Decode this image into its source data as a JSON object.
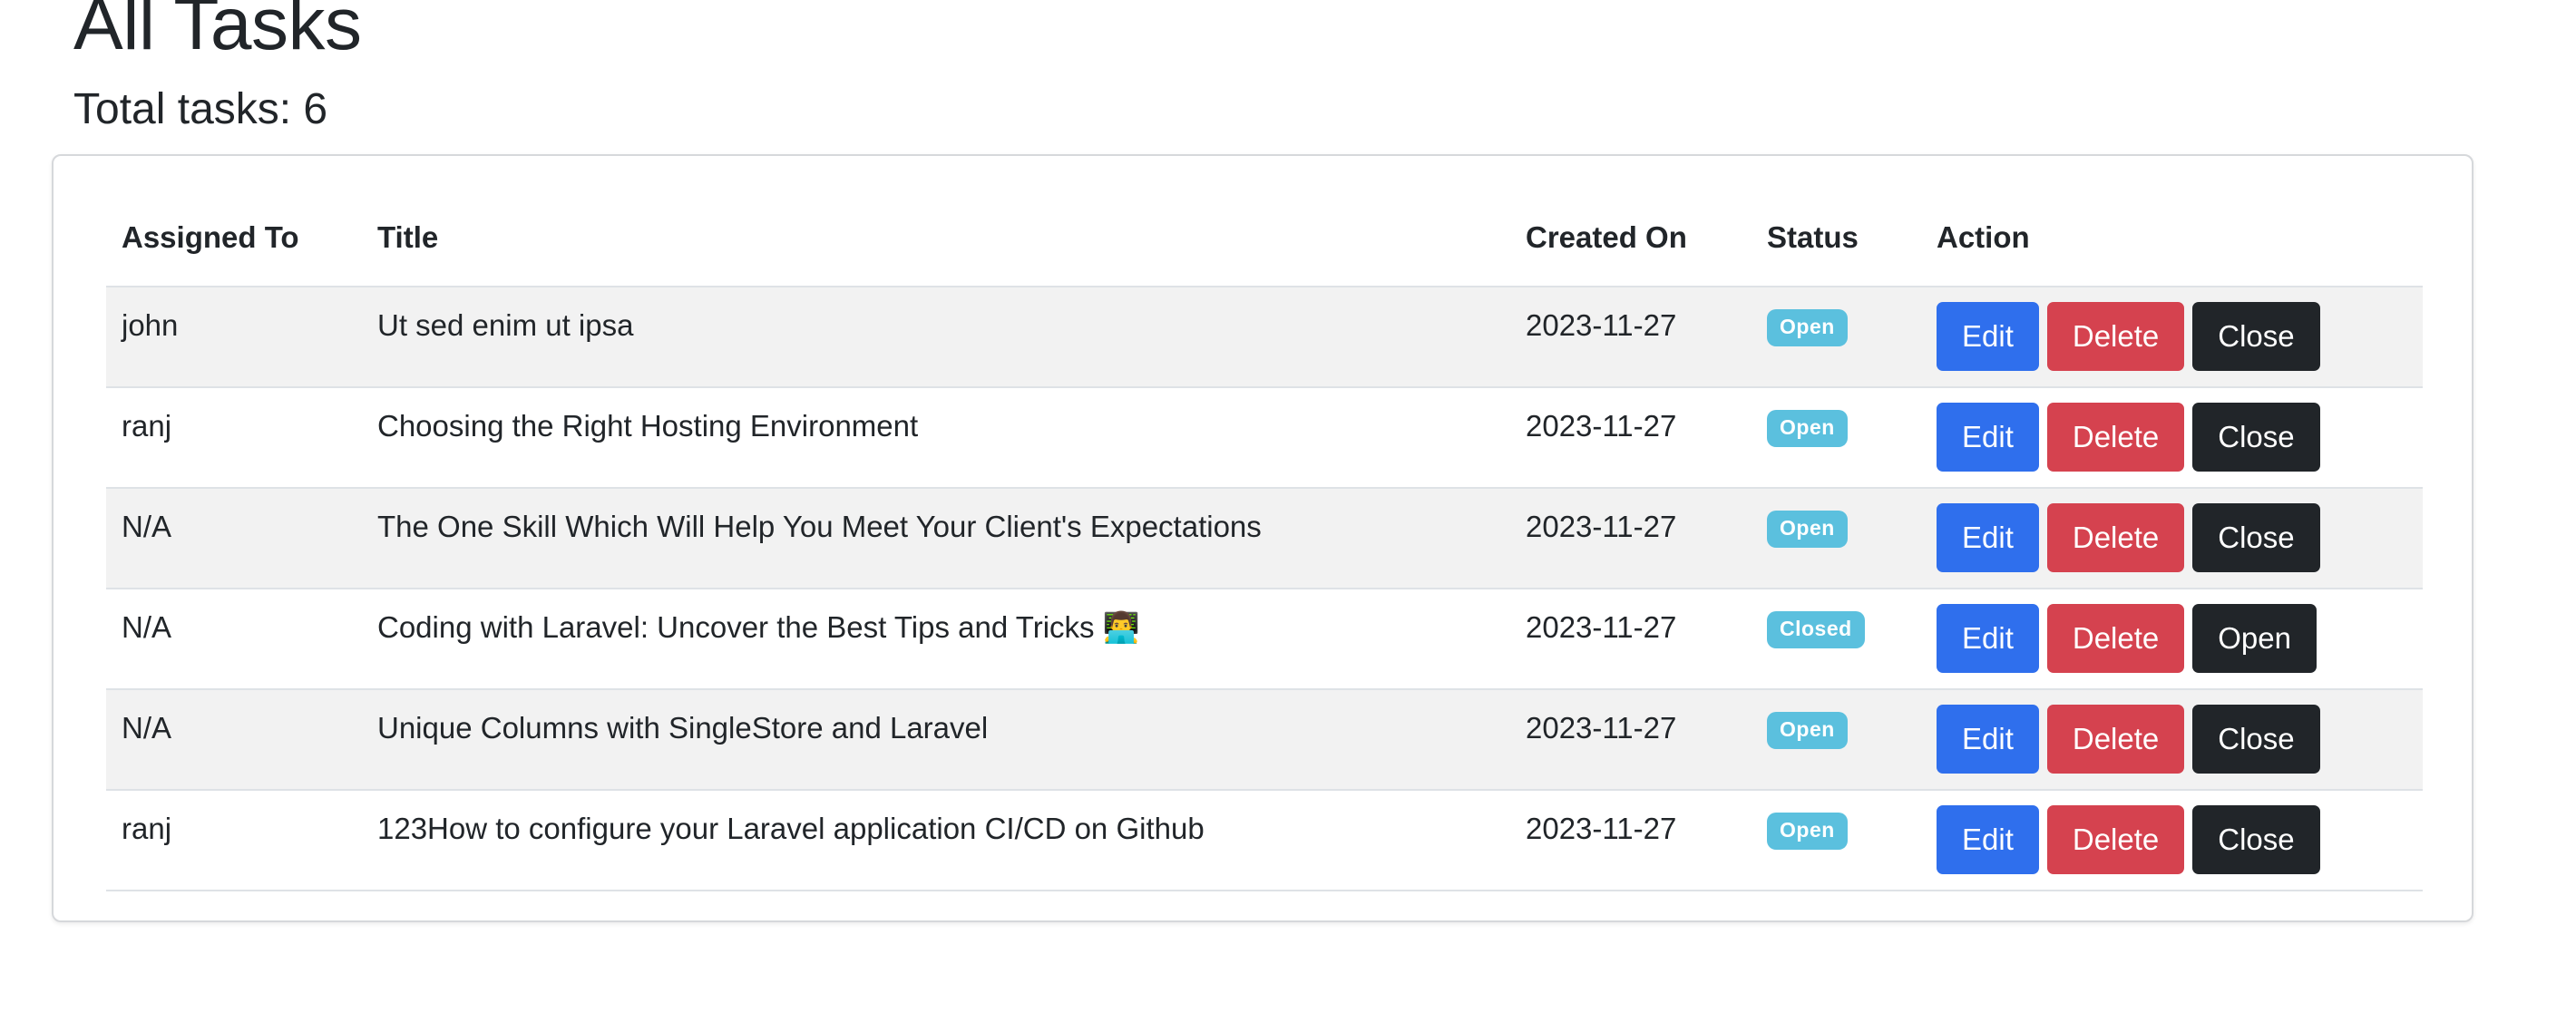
{
  "page": {
    "title": "All Tasks",
    "total_label": "Total tasks: 6"
  },
  "table": {
    "headers": {
      "assigned_to": "Assigned To",
      "title": "Title",
      "created_on": "Created On",
      "status": "Status",
      "action": "Action"
    },
    "rows": [
      {
        "assigned_to": "john",
        "title": "Ut sed enim ut ipsa",
        "created_on": "2023-11-27",
        "status": "Open",
        "actions": {
          "edit": "Edit",
          "delete": "Delete",
          "toggle": "Close"
        }
      },
      {
        "assigned_to": "ranj",
        "title": "Choosing the Right Hosting Environment",
        "created_on": "2023-11-27",
        "status": "Open",
        "actions": {
          "edit": "Edit",
          "delete": "Delete",
          "toggle": "Close"
        }
      },
      {
        "assigned_to": "N/A",
        "title": "The One Skill Which Will Help You Meet Your Client's Expectations",
        "created_on": "2023-11-27",
        "status": "Open",
        "actions": {
          "edit": "Edit",
          "delete": "Delete",
          "toggle": "Close"
        }
      },
      {
        "assigned_to": "N/A",
        "title": "Coding with Laravel: Uncover the Best Tips and Tricks 👨‍💻",
        "created_on": "2023-11-27",
        "status": "Closed",
        "actions": {
          "edit": "Edit",
          "delete": "Delete",
          "toggle": "Open"
        }
      },
      {
        "assigned_to": "N/A",
        "title": "Unique Columns with SingleStore and Laravel",
        "created_on": "2023-11-27",
        "status": "Open",
        "actions": {
          "edit": "Edit",
          "delete": "Delete",
          "toggle": "Close"
        }
      },
      {
        "assigned_to": "ranj",
        "title": "123How to configure your Laravel application CI/CD on Github",
        "created_on": "2023-11-27",
        "status": "Open",
        "actions": {
          "edit": "Edit",
          "delete": "Delete",
          "toggle": "Close"
        }
      }
    ]
  },
  "colors": {
    "edit_button": "#2f6fed",
    "delete_button": "#d5424f",
    "toggle_button": "#212529",
    "status_badge": "#5bc0de",
    "striped_row": "#f2f2f2"
  }
}
